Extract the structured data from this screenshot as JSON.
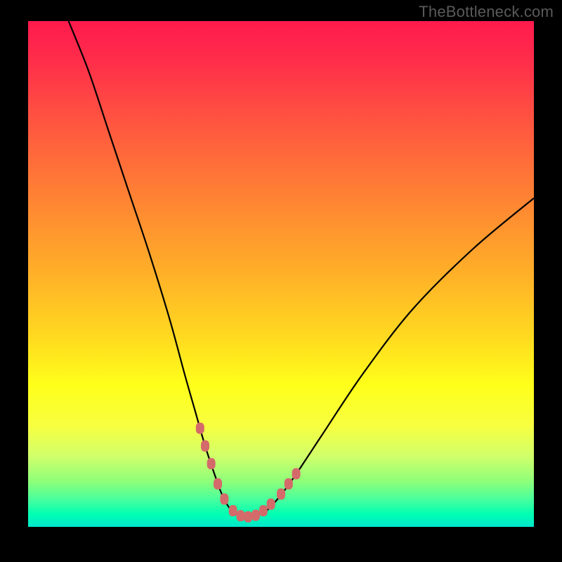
{
  "watermark": "TheBottleneck.com",
  "colors": {
    "background": "#000000",
    "gradient_top": "#ff1a4d",
    "gradient_mid": "#ffff1a",
    "gradient_bottom": "#00e6cc",
    "curve": "#000000",
    "markers": "#d46a6a"
  },
  "chart_data": {
    "type": "line",
    "title": "",
    "xlabel": "",
    "ylabel": "",
    "xlim": [
      0,
      100
    ],
    "ylim": [
      0,
      100
    ],
    "series": [
      {
        "name": "bottleneck-curve",
        "x": [
          8,
          12,
          16,
          20,
          24,
          28,
          31,
          33,
          35,
          37,
          38.5,
          40,
          41.5,
          43,
          44.5,
          46,
          48,
          52,
          58,
          66,
          76,
          88,
          100
        ],
        "y": [
          100,
          90,
          78,
          66,
          54,
          41,
          30,
          23,
          16,
          10,
          6,
          3.5,
          2.3,
          2,
          2.1,
          2.6,
          4,
          9,
          18,
          30,
          43,
          55,
          65
        ]
      }
    ],
    "markers": {
      "name": "highlight-points",
      "points": [
        {
          "x": 34.0,
          "y": 19.5
        },
        {
          "x": 35.0,
          "y": 16.0
        },
        {
          "x": 36.2,
          "y": 12.5
        },
        {
          "x": 37.5,
          "y": 8.5
        },
        {
          "x": 38.8,
          "y": 5.5
        },
        {
          "x": 40.5,
          "y": 3.2
        },
        {
          "x": 42.0,
          "y": 2.2
        },
        {
          "x": 43.5,
          "y": 2.0
        },
        {
          "x": 45.0,
          "y": 2.3
        },
        {
          "x": 46.5,
          "y": 3.2
        },
        {
          "x": 48.0,
          "y": 4.5
        },
        {
          "x": 50.0,
          "y": 6.5
        },
        {
          "x": 51.5,
          "y": 8.5
        },
        {
          "x": 53.0,
          "y": 10.5
        }
      ]
    }
  }
}
